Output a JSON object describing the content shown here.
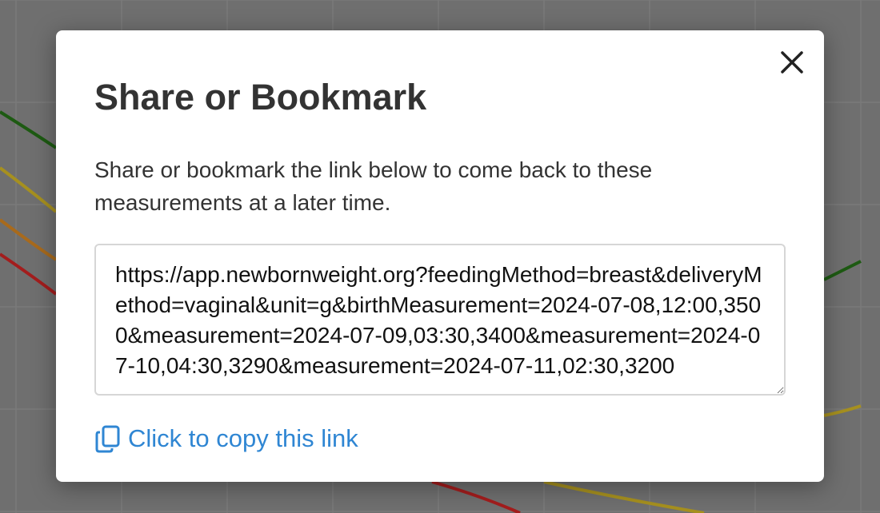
{
  "modal": {
    "title": "Share or Bookmark",
    "description": "Share or bookmark the link below to come back to these measurements at a later time.",
    "link_value": "https://app.newbornweight.org?feedingMethod=breast&deliveryMethod=vaginal&unit=g&birthMeasurement=2024-07-08,12:00,3500&measurement=2024-07-09,03:30,3400&measurement=2024-07-10,04:30,3290&measurement=2024-07-11,02:30,3200",
    "copy_label": "Click to copy this link",
    "close_icon": "close-icon",
    "copy_icon": "copy-icon"
  },
  "colors": {
    "link": "#2f86d3",
    "text": "#333333",
    "backdrop": "#6f6f6f"
  }
}
